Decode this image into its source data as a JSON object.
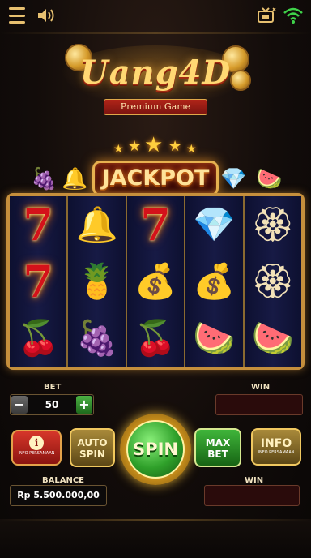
{
  "logo": {
    "title": "Uang4D",
    "subtitle": "Premium Game"
  },
  "jackpot": {
    "label": "JACKPOT"
  },
  "icons": {
    "menu": "menu-icon",
    "sound": "speaker-icon",
    "tv": "tv-icon",
    "wifi": "wifi-icon"
  },
  "reels": [
    [
      "seven",
      "seven",
      "cherries"
    ],
    [
      "bell",
      "pineapple-gold",
      "grapes"
    ],
    [
      "seven",
      "money-bag",
      "cherries"
    ],
    [
      "diamond",
      "money-bag",
      "watermelon"
    ],
    [
      "wayang",
      "wayang",
      "watermelon"
    ]
  ],
  "controls": {
    "bet_label": "BET",
    "bet_value": "50",
    "bet_minus": "−",
    "bet_plus": "+",
    "win_label": "WIN",
    "info_left_label": "INFO PERSAMAAN",
    "auto_spin_line1": "AUTO",
    "auto_spin_line2": "SPIN",
    "spin_label": "SPIN",
    "max_bet_line1": "MAX",
    "max_bet_line2": "BET",
    "info_right_label": "INFO",
    "info_right_sub": "INFO PERSAMAAN",
    "balance_label": "BALANCE",
    "balance_value": "Rp 5.500.000,00",
    "win2_label": "WIN"
  },
  "colors": {
    "gold": "#e7b150",
    "spin_green": "#2fa02a",
    "max_bet_green": "#3fb53a",
    "red": "#d6362a",
    "reel_bg": "#171a45"
  }
}
